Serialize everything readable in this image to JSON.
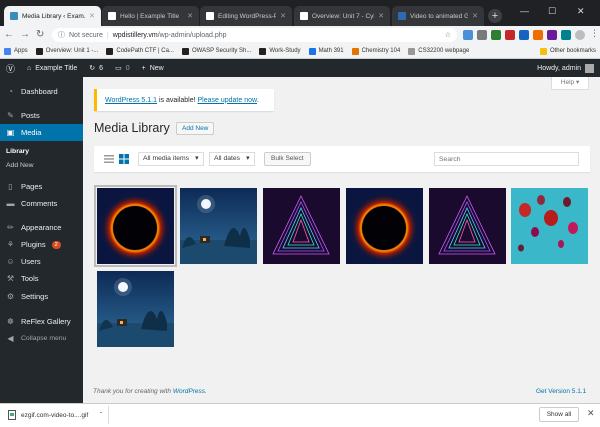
{
  "browser": {
    "tabs": [
      {
        "title": "Media Library ‹ Exam...",
        "active": true,
        "favicon_color": "#3c8dbc"
      },
      {
        "title": "Hello | Example Title",
        "active": false,
        "favicon_color": "#ffffff"
      },
      {
        "title": "Editing WordPress-Pr...",
        "active": false,
        "favicon_color": "#ffffff"
      },
      {
        "title": "Overview: Unit 7 - Cyb...",
        "active": false,
        "favicon_color": "#ffffff"
      },
      {
        "title": "Video to animated GI...",
        "active": false,
        "favicon_color": "#2b6cb0"
      }
    ],
    "new_tab": "+",
    "window_buttons": [
      "—",
      "☐",
      "✕"
    ],
    "address": {
      "security": "Not secure",
      "host": "wpdistillery.vm",
      "path": "/wp-admin/upload.php"
    },
    "bookmarks": [
      {
        "label": "Apps",
        "color": "#4285f4"
      },
      {
        "label": "Overview: Unit 1 -...",
        "color": "#222222"
      },
      {
        "label": "CodePath CTF | Ca...",
        "color": "#222222"
      },
      {
        "label": "OWASP Security Sh...",
        "color": "#222222"
      },
      {
        "label": "Work-Study",
        "color": "#222222"
      },
      {
        "label": "Math 391",
        "color": "#1a73e8"
      },
      {
        "label": "Chemistry 104",
        "color": "#e37400"
      },
      {
        "label": "CS32200 webpage",
        "color": "#999999"
      }
    ],
    "other_bookmarks": "Other bookmarks"
  },
  "adminbar": {
    "site_name": "Example Title",
    "updates": "6",
    "comments": "0",
    "new": "New",
    "greeting": "Howdy, admin"
  },
  "sidebar": {
    "items": [
      {
        "label": "Dashboard",
        "icon": "dashboard-icon",
        "glyph": "◔"
      },
      {
        "label": "Posts",
        "icon": "pin-icon",
        "glyph": "✎"
      },
      {
        "label": "Media",
        "icon": "media-icon",
        "glyph": "▣"
      },
      {
        "label": "Pages",
        "icon": "page-icon",
        "glyph": "▯"
      },
      {
        "label": "Comments",
        "icon": "comment-icon",
        "glyph": "▬"
      },
      {
        "label": "Appearance",
        "icon": "brush-icon",
        "glyph": "✏"
      },
      {
        "label": "Plugins",
        "icon": "plug-icon",
        "glyph": "⚘",
        "badge": "2"
      },
      {
        "label": "Users",
        "icon": "user-icon",
        "glyph": "☺"
      },
      {
        "label": "Tools",
        "icon": "wrench-icon",
        "glyph": "⚒"
      },
      {
        "label": "Settings",
        "icon": "settings-icon",
        "glyph": "⚙"
      },
      {
        "label": "ReFlex Gallery",
        "icon": "gallery-icon",
        "glyph": "☸"
      },
      {
        "label": "Collapse menu",
        "icon": "collapse-icon",
        "glyph": "◀"
      }
    ],
    "media_sub": [
      "Library",
      "Add New"
    ]
  },
  "notice": {
    "link1": "WordPress 5.1.1",
    "text": " is available! ",
    "link2": "Please update now",
    "end": "."
  },
  "help": "Help ▾",
  "page_title": "Media Library",
  "add_new": "Add New",
  "filters": {
    "media_type": "All media items",
    "dates": "All dates",
    "bulk": "Bulk Select",
    "search_placeholder": "Search"
  },
  "media": [
    {
      "name": "eclipse-1",
      "kind": "eclipse"
    },
    {
      "name": "moon-tree-1",
      "kind": "moon"
    },
    {
      "name": "neon-triangle-1",
      "kind": "triangle"
    },
    {
      "name": "eclipse-2",
      "kind": "eclipse"
    },
    {
      "name": "neon-triangle-2",
      "kind": "triangle"
    },
    {
      "name": "balloons",
      "kind": "balloons"
    },
    {
      "name": "moon-tree-2",
      "kind": "moon"
    }
  ],
  "footer": {
    "thanks": "Thank you for creating with ",
    "wp": "WordPress",
    "end": ".",
    "version": "Get Version 5.1.1"
  },
  "download": {
    "file": "ezgif.com-video-to....gif",
    "show_all": "Show all",
    "close": "✕"
  }
}
